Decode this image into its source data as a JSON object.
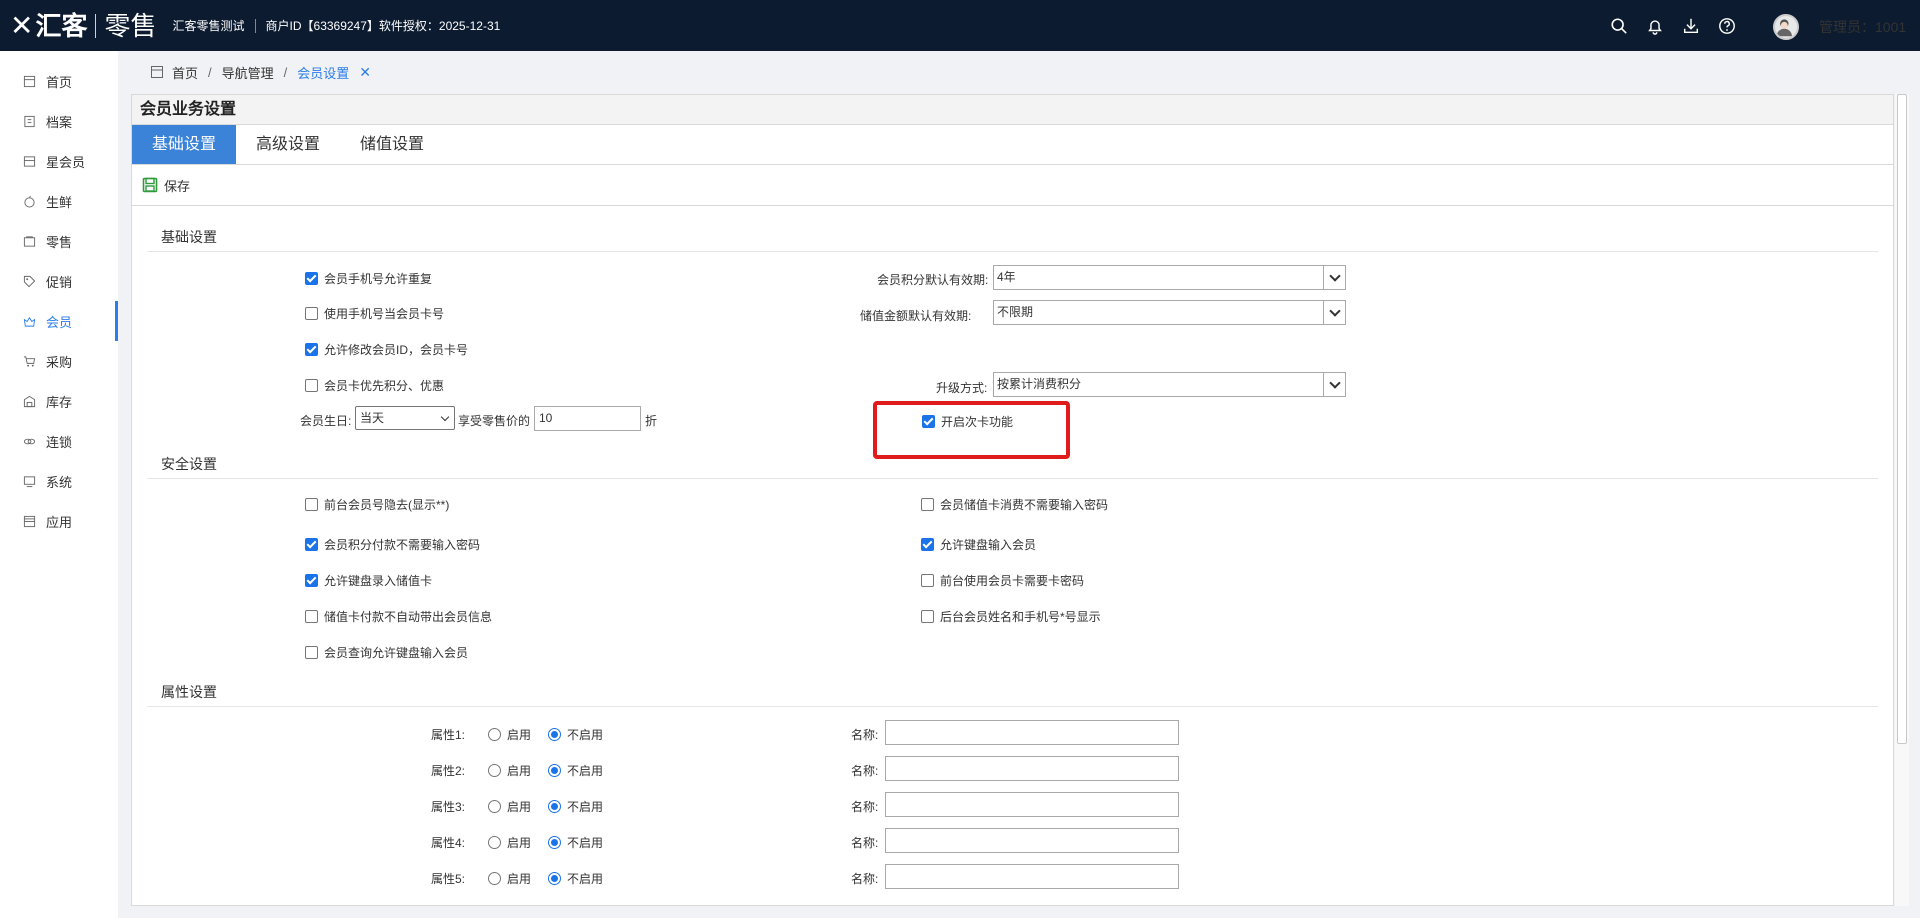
{
  "header": {
    "brand": "汇客",
    "brand_sub": "零售",
    "store_name": "汇客零售测试",
    "merchant_info": "商户ID【63369247】软件授权：2025-12-31",
    "admin": "管理员：1001",
    "icons": [
      "search-icon",
      "bell-icon",
      "download-icon",
      "help-icon",
      "avatar"
    ]
  },
  "sidebar": {
    "items": [
      {
        "label": "首页",
        "icon": "home-icon"
      },
      {
        "label": "档案",
        "icon": "archive-icon"
      },
      {
        "label": "星会员",
        "icon": "star-member-icon"
      },
      {
        "label": "生鲜",
        "icon": "apple-icon"
      },
      {
        "label": "零售",
        "icon": "retail-icon"
      },
      {
        "label": "促销",
        "icon": "tag-icon"
      },
      {
        "label": "会员",
        "icon": "member-icon",
        "active": true
      },
      {
        "label": "采购",
        "icon": "cart-icon"
      },
      {
        "label": "库存",
        "icon": "warehouse-icon"
      },
      {
        "label": "连锁",
        "icon": "chain-icon"
      },
      {
        "label": "系统",
        "icon": "monitor-icon"
      },
      {
        "label": "应用",
        "icon": "apps-icon"
      }
    ]
  },
  "breadcrumb": {
    "home": "首页",
    "nav": "导航管理",
    "current": "会员设置",
    "close": "✕"
  },
  "panel": {
    "title": "会员业务设置",
    "tabs": [
      "基础设置",
      "高级设置",
      "储值设置"
    ],
    "save": "保存"
  },
  "basic": {
    "title": "基础设置",
    "options": [
      {
        "label": "会员手机号允许重复",
        "checked": true
      },
      {
        "label": "使用手机号当会员卡号",
        "checked": false
      },
      {
        "label": "允许修改会员ID，会员卡号",
        "checked": true
      },
      {
        "label": "会员卡优先积分、优惠",
        "checked": false
      }
    ],
    "birthday_label": "会员生日:",
    "birthday_value": "当天",
    "discount_label": "享受零售价的",
    "discount_value": "10",
    "discount_unit": "折",
    "points_expiry_label": "会员积分默认有效期:",
    "points_expiry_value": "4年",
    "stored_expiry_label": "储值金额默认有效期:",
    "stored_expiry_value": "不限期",
    "upgrade_label": "升级方式:",
    "upgrade_value": "按累计消费积分",
    "times_card": {
      "label": "开启次卡功能",
      "checked": true
    }
  },
  "security": {
    "title": "安全设置",
    "left": [
      {
        "label": "前台会员号隐去(显示**)",
        "checked": false
      },
      {
        "label": "会员积分付款不需要输入密码",
        "checked": true
      },
      {
        "label": "允许键盘录入储值卡",
        "checked": true
      },
      {
        "label": "储值卡付款不自动带出会员信息",
        "checked": false
      },
      {
        "label": "会员查询允许键盘输入会员",
        "checked": false
      }
    ],
    "right": [
      {
        "label": "会员储值卡消费不需要输入密码",
        "checked": false
      },
      {
        "label": "允许键盘输入会员",
        "checked": true
      },
      {
        "label": "前台使用会员卡需要卡密码",
        "checked": false
      },
      {
        "label": "后台会员姓名和手机号*号显示",
        "checked": false
      }
    ]
  },
  "attributes": {
    "title": "属性设置",
    "enable_label": "启用",
    "disable_label": "不启用",
    "name_label": "名称:",
    "items": [
      {
        "label": "属性1:",
        "enabled": false,
        "name": ""
      },
      {
        "label": "属性2:",
        "enabled": false,
        "name": ""
      },
      {
        "label": "属性3:",
        "enabled": false,
        "name": ""
      },
      {
        "label": "属性4:",
        "enabled": false,
        "name": ""
      },
      {
        "label": "属性5:",
        "enabled": false,
        "name": ""
      }
    ]
  }
}
